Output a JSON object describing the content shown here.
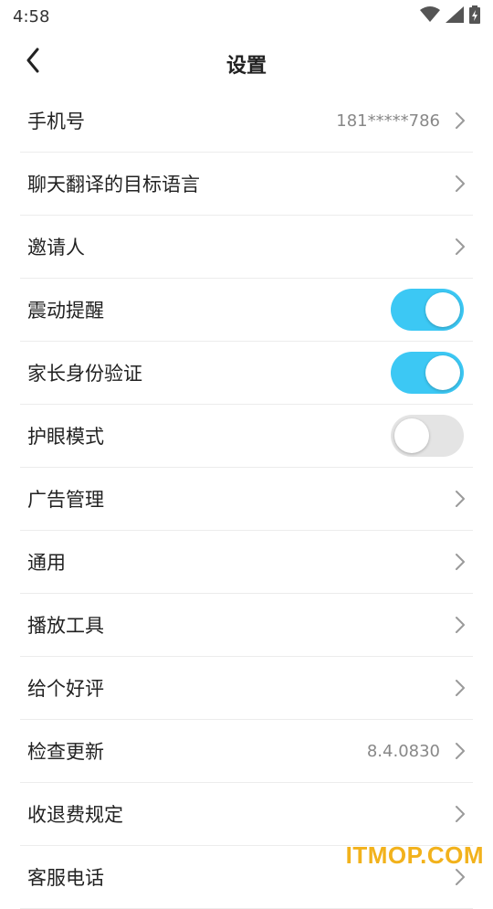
{
  "status_bar": {
    "time": "4:58",
    "icons": [
      "wifi-icon",
      "signal-icon",
      "battery-charging-icon"
    ]
  },
  "header": {
    "title": "设置",
    "back_icon": "chevron-left-icon"
  },
  "colors": {
    "toggle_on": "#3cc8f4",
    "toggle_off": "#e4e4e4",
    "watermark": "#f2b21c"
  },
  "settings": {
    "items": [
      {
        "label": "手机号",
        "value": "181*****786",
        "control": "chevron"
      },
      {
        "label": "聊天翻译的目标语言",
        "control": "chevron"
      },
      {
        "label": "邀请人",
        "control": "chevron"
      },
      {
        "label": "震动提醒",
        "control": "toggle",
        "on": true
      },
      {
        "label": "家长身份验证",
        "control": "toggle",
        "on": true
      },
      {
        "label": "护眼模式",
        "control": "toggle",
        "on": false
      },
      {
        "label": "广告管理",
        "control": "chevron"
      },
      {
        "label": "通用",
        "control": "chevron"
      },
      {
        "label": "播放工具",
        "control": "chevron"
      },
      {
        "label": "给个好评",
        "control": "chevron"
      },
      {
        "label": "检查更新",
        "value": "8.4.0830",
        "control": "chevron"
      },
      {
        "label": "收退费规定",
        "control": "chevron"
      },
      {
        "label": "客服电话",
        "control": "chevron"
      }
    ]
  },
  "watermark": {
    "text": "ITMOP.COM"
  }
}
